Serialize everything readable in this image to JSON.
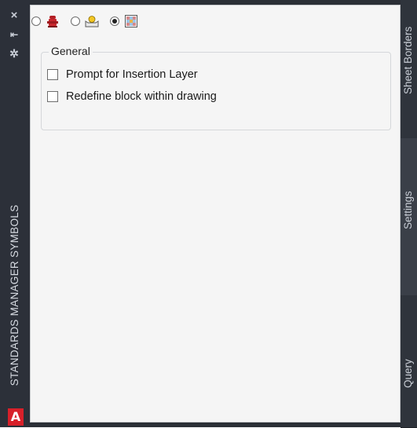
{
  "palette": {
    "title": "STANDARDS MANAGER SYMBOLS",
    "logo": "A",
    "titlebar_icons": [
      "close-icon",
      "auto-hide-icon",
      "properties-icon"
    ]
  },
  "view_options": [
    {
      "name": "fire-hydrant-icon",
      "selected": false
    },
    {
      "name": "tray-symbol-icon",
      "selected": false
    },
    {
      "name": "pattern-grid-icon",
      "selected": true
    }
  ],
  "general": {
    "title": "General",
    "options": [
      {
        "label": "Prompt for Insertion Layer",
        "checked": false
      },
      {
        "label": "Redefine block within drawing",
        "checked": false
      }
    ]
  },
  "tabs": [
    {
      "label": "Sheet Borders"
    },
    {
      "label": "Settings"
    },
    {
      "label": "Query"
    }
  ],
  "colors": {
    "accent": "#d8202a",
    "panel_bg": "#f5f5f5",
    "dark_chrome": "#2b2f36"
  }
}
